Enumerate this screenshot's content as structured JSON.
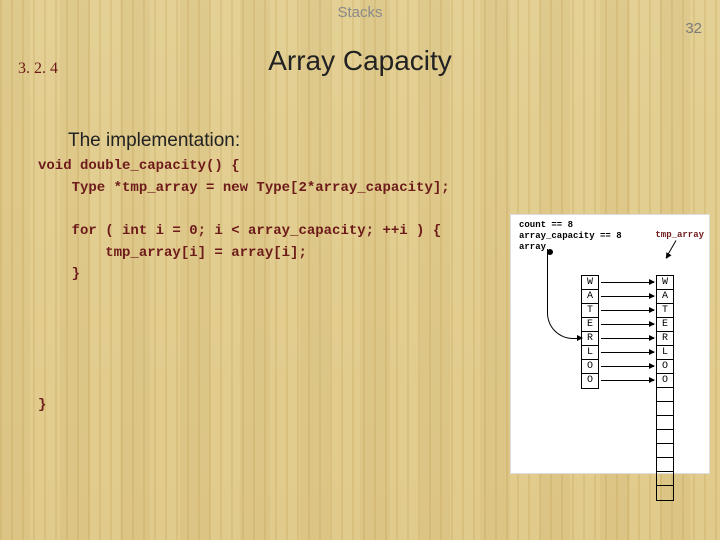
{
  "header": {
    "subject": "Stacks"
  },
  "page_number": "32",
  "section_number": "3. 2. 4",
  "title": "Array Capacity",
  "subtitle": "The implementation:",
  "code": {
    "l1": "void double_capacity() {",
    "l2": "    Type *tmp_array = new Type[2*array_capacity];",
    "l3": "",
    "l4": "    for ( int i = 0; i < array_capacity; ++i ) {",
    "l5": "        tmp_array[i] = array[i];",
    "l6": "    }",
    "l7": "",
    "l8": "",
    "l9": "",
    "l10": "",
    "l11": "",
    "l12": "}"
  },
  "diagram": {
    "count_label": "count == 8",
    "capacity_label": "array_capacity == 8",
    "array_label": "array",
    "tmp_label": "tmp_array",
    "left_cells": [
      "W",
      "A",
      "T",
      "E",
      "R",
      "L",
      "O",
      "O"
    ],
    "right_cells": [
      "W",
      "A",
      "T",
      "E",
      "R",
      "L",
      "O",
      "O",
      "",
      "",
      "",
      "",
      "",
      "",
      "",
      ""
    ]
  }
}
